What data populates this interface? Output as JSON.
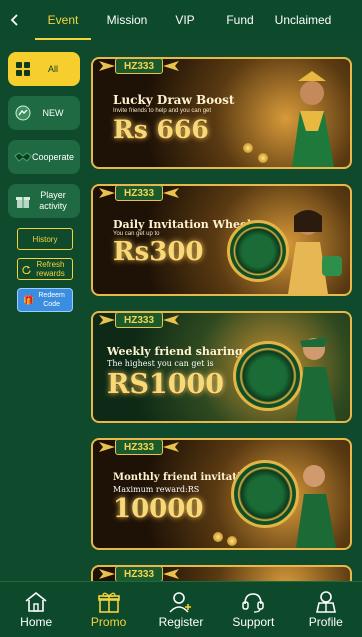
{
  "nav": {
    "back_icon": "chevron-left-icon",
    "tabs": [
      "Event",
      "Mission",
      "VIP",
      "Fund",
      "Unclaimed"
    ],
    "active_tab": "Event"
  },
  "sidebar": {
    "items": [
      {
        "label": "All",
        "icon": "grid-icon",
        "active": true
      },
      {
        "label": "NEW",
        "icon": "messenger-icon",
        "active": false
      },
      {
        "label": "Cooperate",
        "icon": "handshake-icon",
        "active": false
      },
      {
        "label": "Player activity",
        "icon": "gift-icon",
        "active": false
      }
    ],
    "history_label": "History",
    "refresh_label": "Refresh rewards",
    "redeem_label": "Redeem Code"
  },
  "banners": [
    {
      "brand": "HZ333",
      "title": "Lucky Draw Boost",
      "subtitle": "Invite friends to help and you can get",
      "amount": "Rs 666"
    },
    {
      "brand": "HZ333",
      "title": "Daily Invitation Wheel",
      "subtitle": "You can get up to",
      "amount": "Rs300"
    },
    {
      "brand": "HZ333",
      "title": "Weekly friend sharing",
      "subtitle": "The highest you can get is",
      "amount": "RS1000"
    },
    {
      "brand": "HZ333",
      "title": "Monthly friend invitations",
      "subtitle": "Maximum reward:RS",
      "amount": "10000"
    },
    {
      "brand": "HZ333",
      "title": "",
      "subtitle": "",
      "amount": ""
    }
  ],
  "bottom_nav": {
    "items": [
      {
        "label": "Home",
        "icon": "home-icon"
      },
      {
        "label": "Promo",
        "icon": "gift-icon"
      },
      {
        "label": "Register",
        "icon": "add-user-icon"
      },
      {
        "label": "Support",
        "icon": "headset-icon"
      },
      {
        "label": "Profile",
        "icon": "profile-icon"
      }
    ],
    "active": "Promo"
  },
  "colors": {
    "background": "#0f4a2c",
    "accent": "#f5d33b",
    "banner_border": "#e9b84a",
    "redeem": "#3b8de0"
  }
}
